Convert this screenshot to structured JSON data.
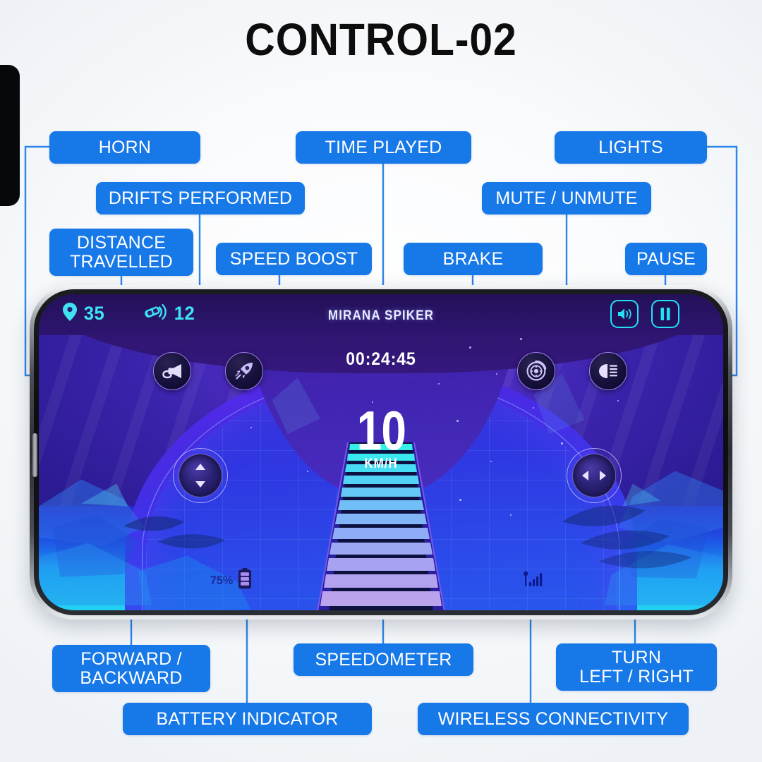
{
  "page": {
    "title": "CONTROL-02"
  },
  "callouts": [
    {
      "id": "horn",
      "label": "HORN"
    },
    {
      "id": "time",
      "label": "TIME PLAYED"
    },
    {
      "id": "lights",
      "label": "LIGHTS"
    },
    {
      "id": "drifts",
      "label": "DRIFTS PERFORMED"
    },
    {
      "id": "mute",
      "label": "MUTE / UNMUTE"
    },
    {
      "id": "distance",
      "label": "DISTANCE\nTRAVELLED"
    },
    {
      "id": "boost",
      "label": "SPEED BOOST"
    },
    {
      "id": "brake",
      "label": "BRAKE"
    },
    {
      "id": "pause",
      "label": "PAUSE"
    },
    {
      "id": "forward",
      "label": "FORWARD /\nBACKWARD"
    },
    {
      "id": "speedo",
      "label": "SPEEDOMETER"
    },
    {
      "id": "turn",
      "label": "TURN\nLEFT / RIGHT"
    },
    {
      "id": "battery",
      "label": "BATTERY INDICATOR"
    },
    {
      "id": "wireless",
      "label": "WIRELESS CONNECTIVITY"
    }
  ],
  "game": {
    "app_name": "MIRANA SPIKER",
    "timer": "00:24:45",
    "distance_value": "35",
    "drifts_value": "12",
    "speed_value": "10",
    "speed_unit": "KM/H",
    "battery_percent": "75%",
    "icons": {
      "location_pin": "location-pin-icon",
      "drift_car": "drift-car-icon",
      "horn": "horn-icon",
      "boost": "rocket-icon",
      "brake": "brake-disc-icon",
      "headlight": "headlight-icon",
      "mute": "speaker-icon",
      "pause": "pause-icon",
      "battery": "battery-icon",
      "signal": "signal-bars-icon"
    }
  },
  "colors": {
    "chip_blue": "#1778e8",
    "connector_blue": "#2a86e8",
    "hud_cyan": "#3fe3f0",
    "accent_cyan": "#25e0f5",
    "title_black": "#0d0d0d"
  }
}
